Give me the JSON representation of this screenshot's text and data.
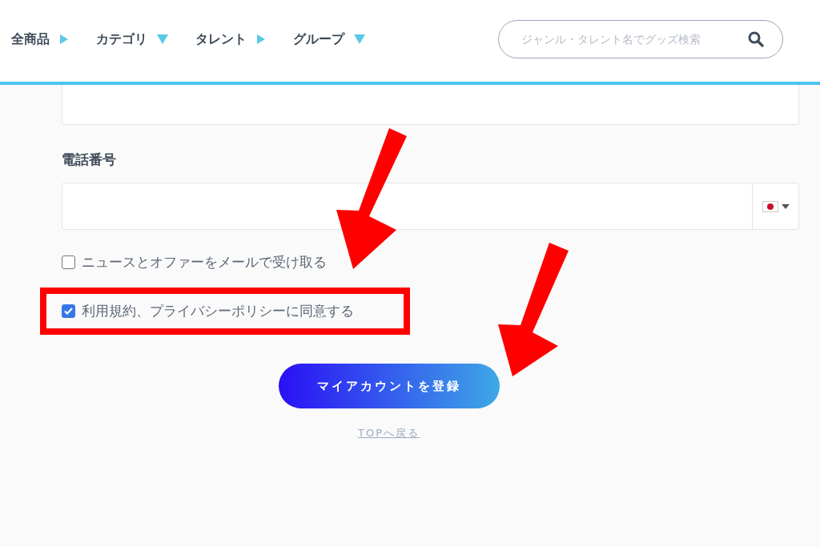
{
  "nav": {
    "items": [
      {
        "label": "全商品",
        "kind": "right"
      },
      {
        "label": "カテゴリ",
        "kind": "down"
      },
      {
        "label": "タレント",
        "kind": "right"
      },
      {
        "label": "グループ",
        "kind": "down"
      }
    ],
    "search": {
      "placeholder": "ジャンル・タレント名でグッズ検索"
    }
  },
  "form": {
    "phone": {
      "label": "電話番号"
    },
    "options": [
      {
        "label": "ニュースとオファーをメールで受け取る",
        "checked": false,
        "highlighted": false
      },
      {
        "label": "利用規約、プライバシーポリシーに同意する",
        "checked": true,
        "highlighted": true
      }
    ],
    "submit": "マイアカウントを登録",
    "back_link": "TOPへ戻る"
  }
}
